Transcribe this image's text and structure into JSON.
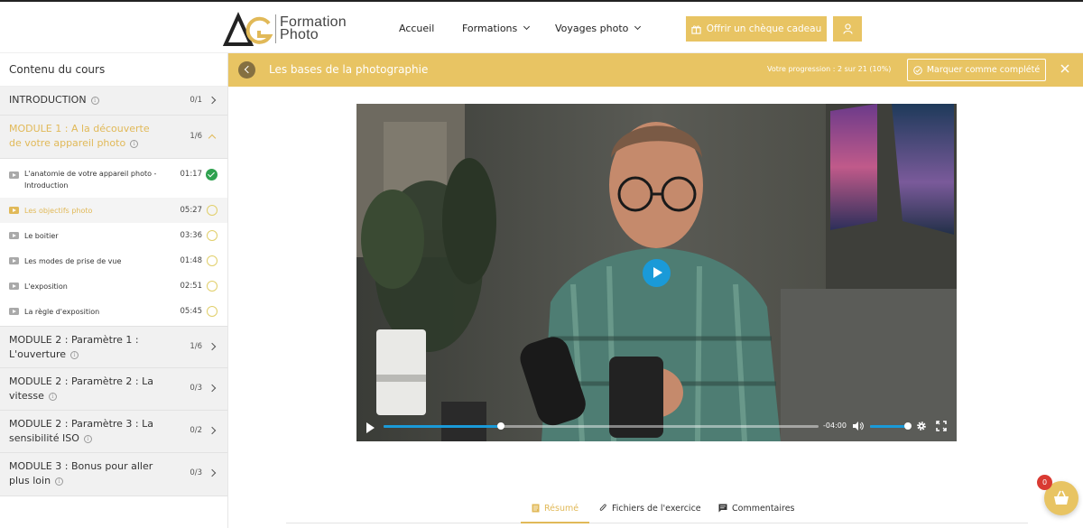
{
  "header": {
    "logo_initials": "AG",
    "logo_line1": "Formation",
    "logo_line2": "Photo",
    "nav": [
      {
        "label": "Accueil"
      },
      {
        "label": "Formations"
      },
      {
        "label": "Voyages photo"
      }
    ],
    "gift_button": "Offrir un chèque cadeau",
    "accent_color": "#e8c463"
  },
  "sidebar": {
    "title": "Contenu du cours",
    "modules": [
      {
        "title": "INTRODUCTION",
        "count": "0/1"
      },
      {
        "title": "MODULE 1 : A la découverte de votre appareil photo",
        "count": "1/6"
      },
      {
        "title": "MODULE 2 : Paramètre 1 : L'ouverture",
        "count": "1/6"
      },
      {
        "title": "MODULE 2 : Paramètre 2 : La vitesse",
        "count": "0/3"
      },
      {
        "title": "MODULE 2 : Paramètre 3 : La sensibilité ISO",
        "count": "0/2"
      },
      {
        "title": "MODULE 3 : Bonus pour aller plus loin",
        "count": "0/3"
      }
    ],
    "lessons": [
      {
        "title": "L'anatomie de votre appareil photo - Introduction",
        "time": "01:17",
        "done": true
      },
      {
        "title": "Les objectifs photo",
        "time": "05:27",
        "done": false
      },
      {
        "title": "Le boitier",
        "time": "03:36",
        "done": false
      },
      {
        "title": "Les modes de prise de vue",
        "time": "01:48",
        "done": false
      },
      {
        "title": "L'exposition",
        "time": "02:51",
        "done": false
      },
      {
        "title": "La règle d'exposition",
        "time": "05:45",
        "done": false
      }
    ]
  },
  "course": {
    "title": "Les bases de la photographie",
    "progress_label": "Votre progression :",
    "progress_text": "2 sur 21 (10%)",
    "progress_fraction": 0.1,
    "complete_button": "Marquer comme complété"
  },
  "video": {
    "time_remaining": "-04:00",
    "played_fraction": 0.27,
    "volume_fraction": 1.0
  },
  "tabs": [
    {
      "label": "Résumé"
    },
    {
      "label": "Fichiers de l'exercice"
    },
    {
      "label": "Commentaires"
    }
  ],
  "cart": {
    "count": "0"
  }
}
